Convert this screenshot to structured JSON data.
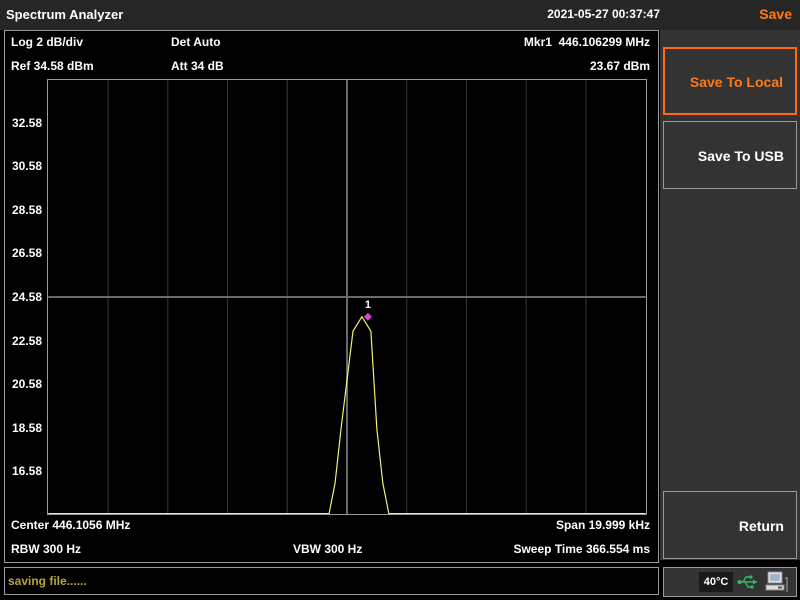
{
  "app_title": "Spectrum Analyzer",
  "datetime": "2021-05-27 00:37:47",
  "menu_title": "Save",
  "header": {
    "scale": "Log 2 dB/div",
    "detector": "Det Auto",
    "marker_label": "Mkr1  446.106299 MHz",
    "ref_level": "Ref 34.58 dBm",
    "attenuation": "Att 34 dB",
    "marker_amplitude": "23.67 dBm"
  },
  "footer": {
    "center": "Center 446.1056 MHz",
    "span": "Span 19.999 kHz",
    "rbw": "RBW 300 Hz",
    "vbw": "VBW 300 Hz",
    "sweep_time": "Sweep Time 366.554 ms"
  },
  "softkeys": {
    "save_local": "Save To Local",
    "save_usb": "Save To USB",
    "return": "Return"
  },
  "status_text": "saving file......",
  "temperature": "40°C",
  "icons": [
    "usb-icon",
    "network-computer-icon"
  ],
  "colors": {
    "accent": "#ff7a1a",
    "trace": "#f2f270",
    "marker": "#e040e0",
    "status_text": "#b5a43a"
  },
  "chart_data": {
    "type": "line",
    "xlabel": "",
    "ylabel": "",
    "y_ticks": [
      "32.58",
      "30.58",
      "28.58",
      "26.58",
      "24.58",
      "22.58",
      "20.58",
      "18.58",
      "16.58"
    ],
    "ylim": [
      14.58,
      34.58
    ],
    "xlim": [
      446.0956,
      446.1156
    ],
    "grid": true,
    "series": [
      {
        "x": [
          446.0956,
          446.1041,
          446.105,
          446.1052,
          446.1054,
          446.1058,
          446.1061,
          446.1064,
          446.1066,
          446.1068,
          446.107,
          446.1072,
          446.1156
        ],
        "y": [
          14.6,
          14.6,
          14.6,
          16.0,
          18.5,
          23.0,
          23.67,
          23.0,
          18.5,
          16.0,
          14.6,
          14.6,
          14.6
        ]
      }
    ],
    "markers": [
      {
        "label": "1",
        "x": 446.106299,
        "y": 23.67
      }
    ]
  }
}
